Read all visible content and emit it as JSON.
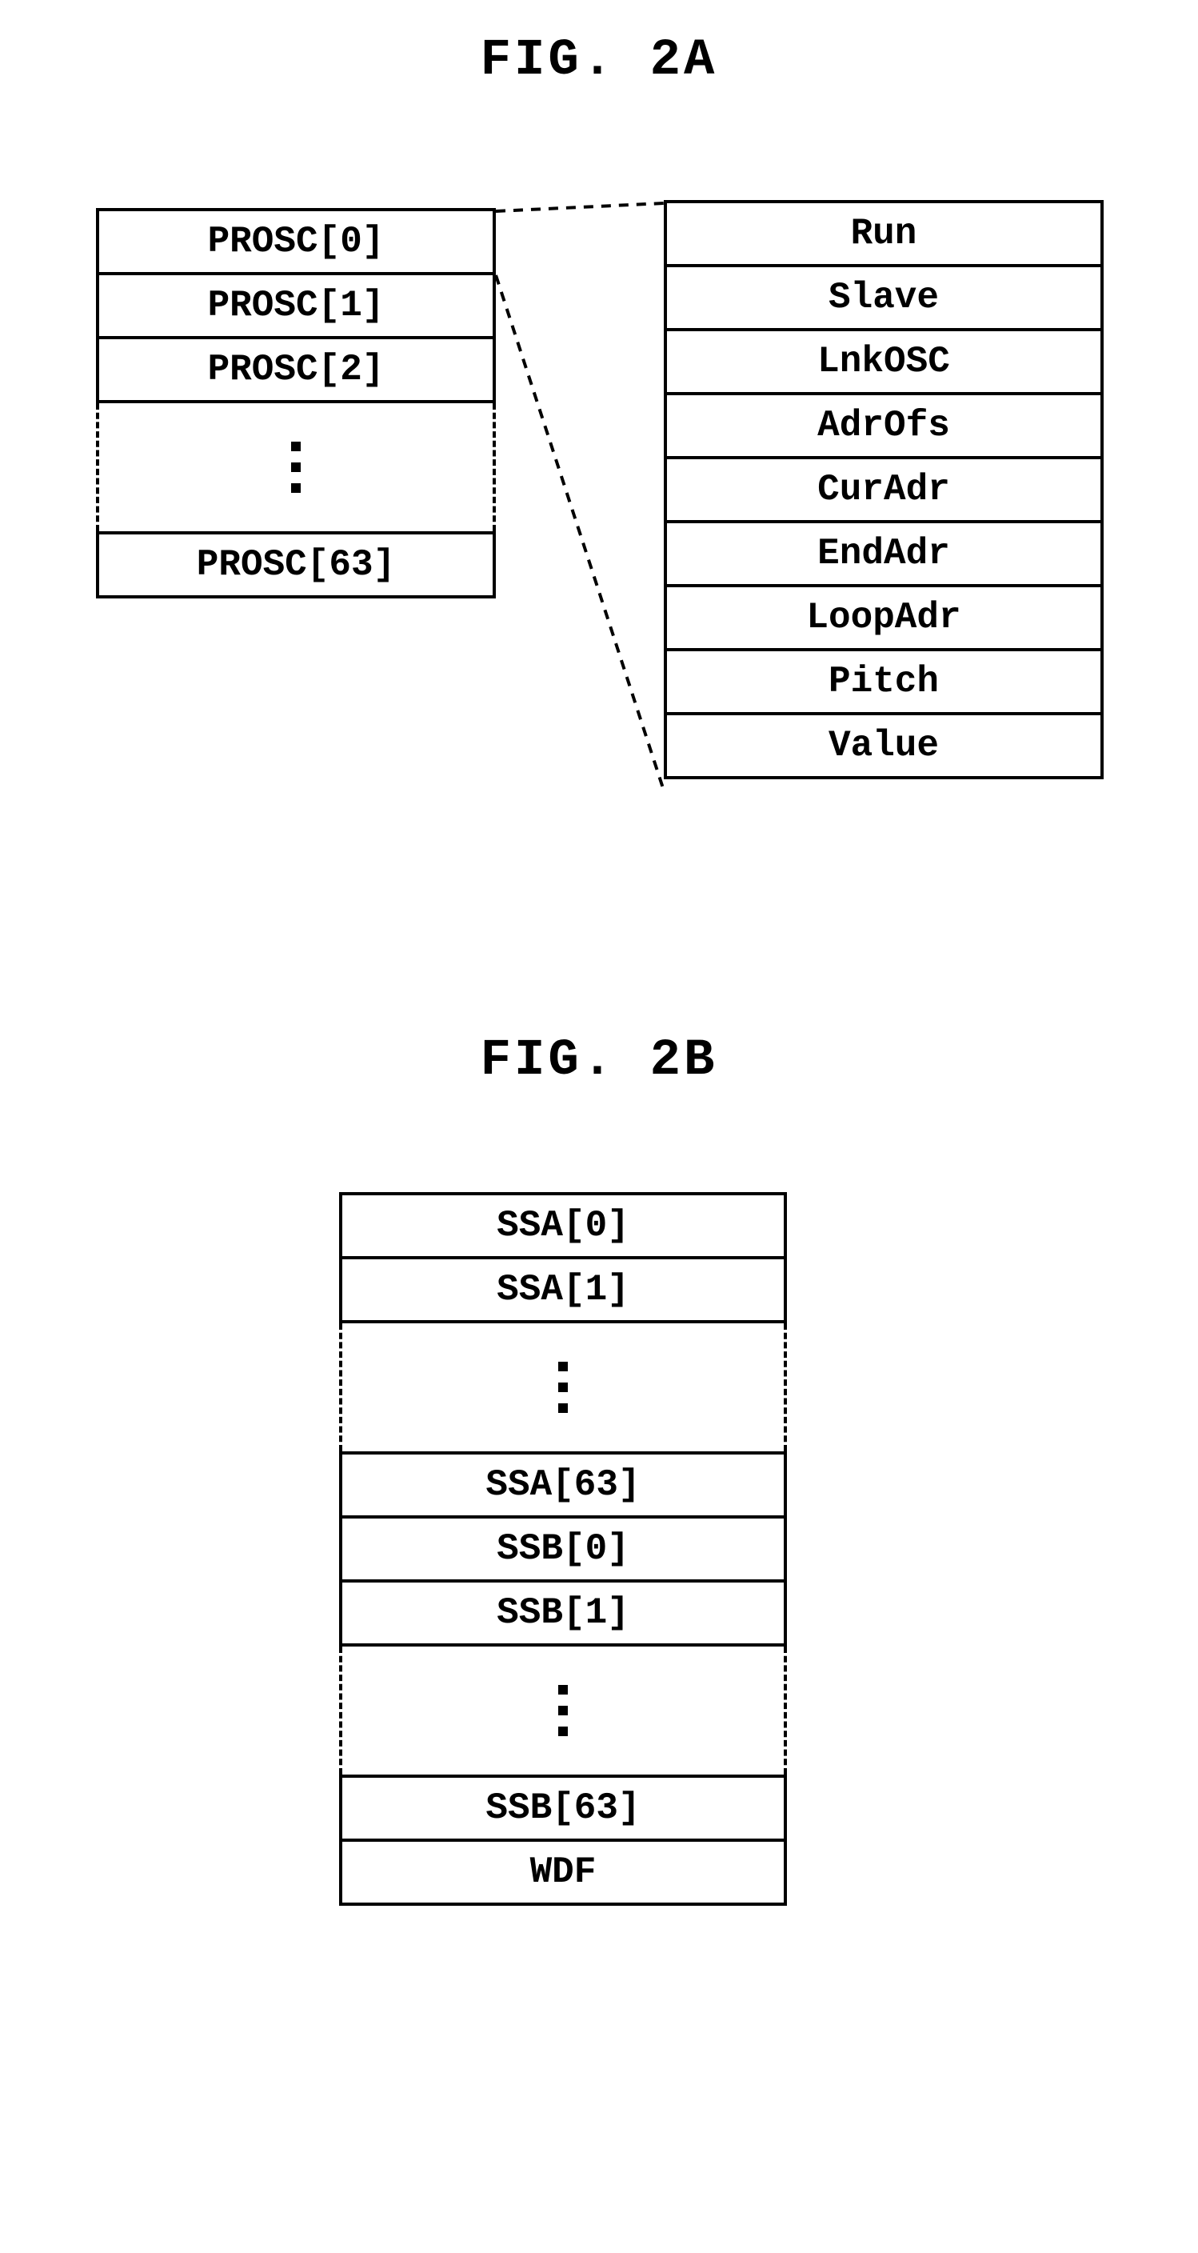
{
  "figA": {
    "title": "FIG. 2A",
    "left": [
      "PROSC[0]",
      "PROSC[1]",
      "PROSC[2]",
      "PROSC[63]"
    ],
    "right": [
      "Run",
      "Slave",
      "LnkOSC",
      "AdrOfs",
      "CurAdr",
      "EndAdr",
      "LoopAdr",
      "Pitch",
      "Value"
    ]
  },
  "figB": {
    "title": "FIG. 2B",
    "rows": [
      "SSA[0]",
      "SSA[1]",
      "SSA[63]",
      "SSB[0]",
      "SSB[1]",
      "SSB[63]",
      "WDF"
    ]
  }
}
